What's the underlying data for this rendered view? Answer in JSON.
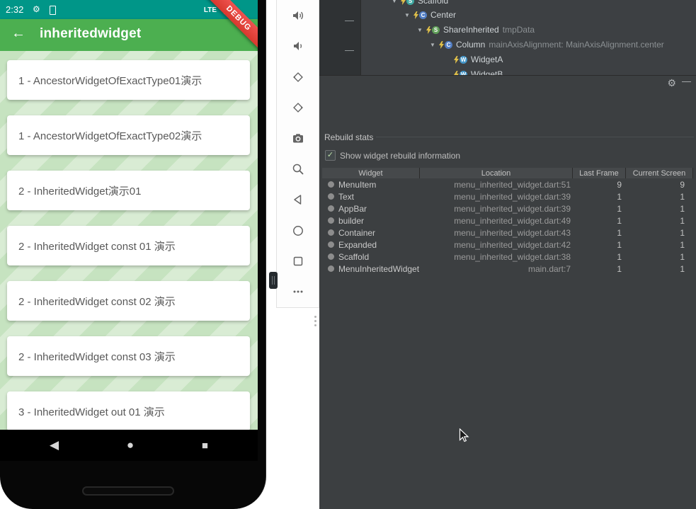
{
  "colors": {
    "app_bar_green": "#4caf50",
    "status_bar_teal": "#009688",
    "ide_background": "#3c3f41",
    "debug_banner_red": "#d8382e",
    "list_background_stripe_light": "#d9ecd4",
    "list_background_stripe_dark": "#c6e3c0"
  },
  "icons": {
    "back_arrow": "←",
    "expand_arrow": "▼",
    "gear": "⚙",
    "minimize": "—",
    "handle_dash": "—",
    "nav_back": "◀",
    "nav_home": "●",
    "nav_overview": "■",
    "check": "✓"
  },
  "phone": {
    "status_bar": {
      "time": "2:32",
      "network": "LTE"
    },
    "app_bar": {
      "title": "inheritedwidget"
    },
    "debug_banner": "DEBUG",
    "menu_items": [
      {
        "label": "1 - AncestorWidgetOfExactType01演示"
      },
      {
        "label": "1 - AncestorWidgetOfExactType02演示"
      },
      {
        "label": "2 - InheritedWidget演示01"
      },
      {
        "label": "2 - InheritedWidget const 01 演示"
      },
      {
        "label": "2 - InheritedWidget const 02 演示"
      },
      {
        "label": "2 - InheritedWidget const 03 演示"
      },
      {
        "label": "3 - InheritedWidget out 01 演示"
      }
    ]
  },
  "emulator_toolbar": {
    "buttons": [
      "volume-up",
      "volume-down",
      "rotate-left",
      "rotate-right",
      "take-screenshot",
      "zoom",
      "back",
      "home",
      "overview",
      "more"
    ]
  },
  "inspector": {
    "tree": {
      "items": [
        {
          "name": "Scaffold",
          "badge": "S",
          "suffix": ""
        },
        {
          "name": "Center",
          "badge": "C",
          "suffix": ""
        },
        {
          "name": "ShareInherited",
          "badge": "S",
          "suffix": "tmpData"
        },
        {
          "name": "Column",
          "badge": "C",
          "suffix": "mainAxisAlignment: MainAxisAlignment.center"
        },
        {
          "name": "WidgetA",
          "badge": "W",
          "suffix": ""
        },
        {
          "name": "WidgetB",
          "badge": "W",
          "suffix": ""
        }
      ]
    },
    "rebuild_stats": {
      "title": "Rebuild stats",
      "checkbox_label": "Show widget rebuild information",
      "checkbox_checked": true,
      "table": {
        "columns": [
          "Widget",
          "Location",
          "Last Frame",
          "Current Screen"
        ],
        "rows": [
          {
            "widget": "MenuItem",
            "location": "menu_inherited_widget.dart:51",
            "last_frame": "9",
            "current_screen": "9"
          },
          {
            "widget": "Text",
            "location": "menu_inherited_widget.dart:39",
            "last_frame": "1",
            "current_screen": "1"
          },
          {
            "widget": "AppBar",
            "location": "menu_inherited_widget.dart:39",
            "last_frame": "1",
            "current_screen": "1"
          },
          {
            "widget": "builder",
            "location": "menu_inherited_widget.dart:49",
            "last_frame": "1",
            "current_screen": "1"
          },
          {
            "widget": "Container",
            "location": "menu_inherited_widget.dart:43",
            "last_frame": "1",
            "current_screen": "1"
          },
          {
            "widget": "Expanded",
            "location": "menu_inherited_widget.dart:42",
            "last_frame": "1",
            "current_screen": "1"
          },
          {
            "widget": "Scaffold",
            "location": "menu_inherited_widget.dart:38",
            "last_frame": "1",
            "current_screen": "1"
          },
          {
            "widget": "MenuInheritedWidget",
            "location": "main.dart:7",
            "last_frame": "1",
            "current_screen": "1"
          }
        ]
      }
    }
  }
}
